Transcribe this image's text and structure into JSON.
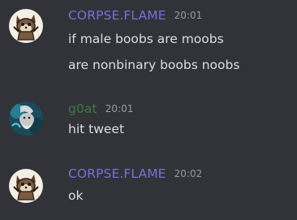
{
  "messages": [
    {
      "author": "CORPSE.FLAME",
      "author_color": "#7c6dd8",
      "avatar_icon": "fox-sticker-avatar",
      "time": "20:01",
      "lines": [
        "if male boobs are moobs",
        "are nonbinary boobs noobs"
      ]
    },
    {
      "author": "g0at",
      "author_color": "#3d7b3e",
      "avatar_icon": "wizard-avatar",
      "time": "20:01",
      "lines": [
        "hit tweet"
      ]
    },
    {
      "author": "CORPSE.FLAME",
      "author_color": "#7c6dd8",
      "avatar_icon": "fox-sticker-avatar",
      "time": "20:02",
      "lines": [
        "ok"
      ]
    }
  ]
}
